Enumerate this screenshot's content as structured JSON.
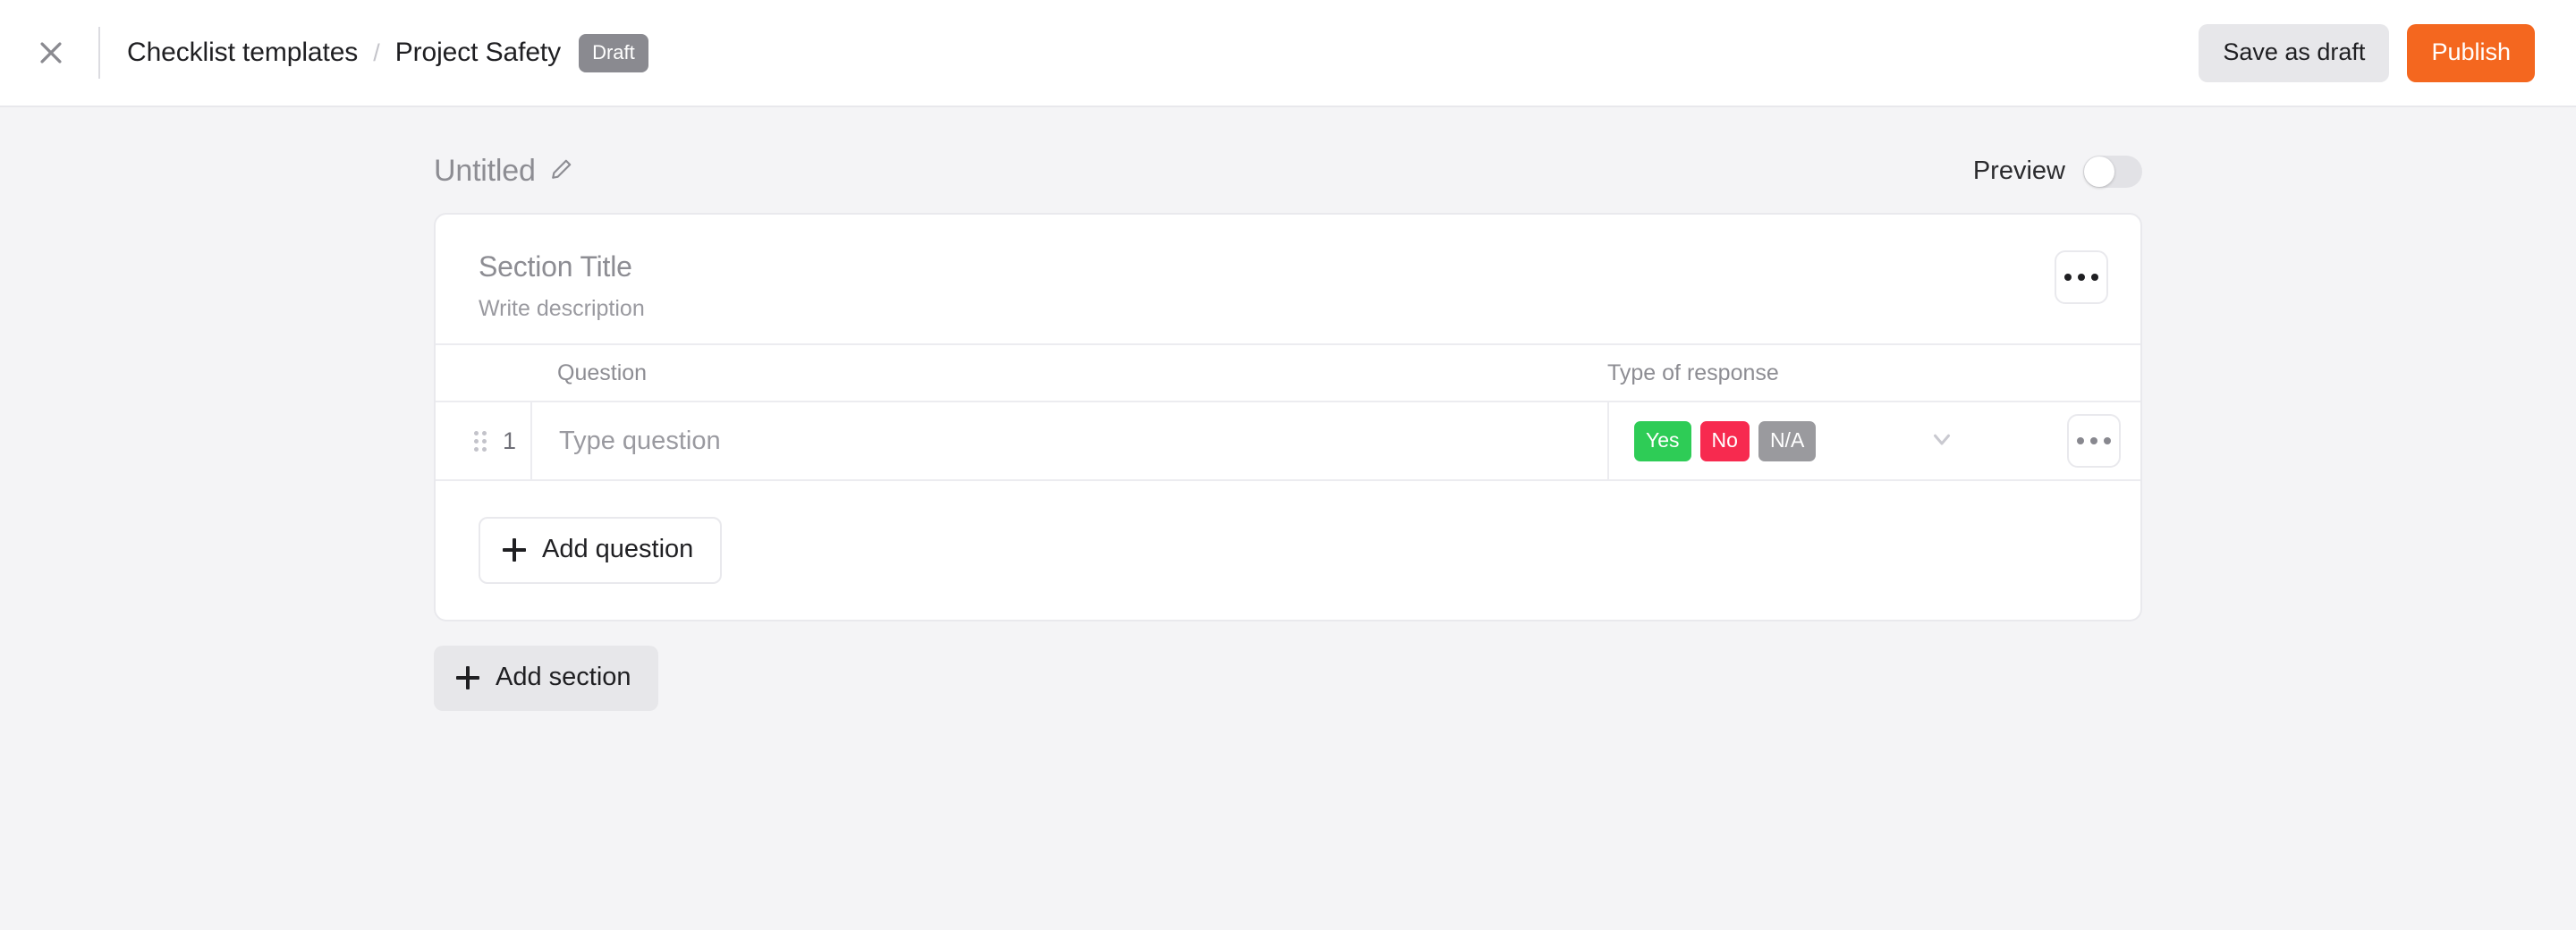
{
  "topbar": {
    "close_icon": "close-icon",
    "breadcrumb": {
      "root_label": "Checklist templates",
      "separator": "/",
      "current_label": "Project Safety",
      "status_badge": "Draft",
      "status_badge_color": "#8a8a90"
    },
    "actions": {
      "save_draft_label": "Save as draft",
      "publish_label": "Publish",
      "publish_color": "#f4671f",
      "save_draft_color": "#e7e7ea"
    }
  },
  "document": {
    "title": "Untitled",
    "edit_icon": "pencil-icon",
    "preview_label": "Preview",
    "preview_enabled": false
  },
  "section": {
    "title": "Section Title",
    "description": "Write description",
    "menu_icon": "ellipsis-icon",
    "table": {
      "columns": [
        "Question",
        "Type of response"
      ],
      "rows": [
        {
          "number": "1",
          "question_placeholder": "Type question",
          "response_chips": [
            {
              "label": "Yes",
              "color": "#2ecc56"
            },
            {
              "label": "No",
              "color": "#f72a4f"
            },
            {
              "label": "N/A",
              "color": "#9a9a9e"
            }
          ],
          "expand_icon": "chevron-down-icon",
          "menu_icon": "ellipsis-icon",
          "drag_handle_icon": "drag-handle-icon"
        }
      ]
    },
    "add_question_label": "Add question"
  },
  "footer": {
    "add_section_label": "Add section"
  }
}
